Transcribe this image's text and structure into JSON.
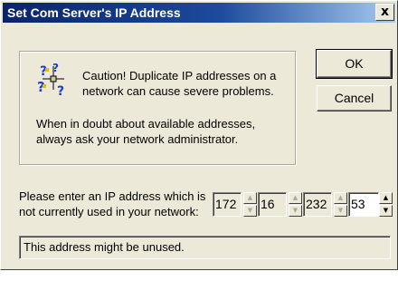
{
  "window": {
    "title": "Set Com Server's IP Address",
    "close_glyph": "x"
  },
  "info": {
    "icon": "help-question-icon",
    "caution": "Caution! Duplicate IP addresses on a network can cause severe problems.",
    "doubt": "When in doubt about available addresses, always ask your network administrator."
  },
  "buttons": {
    "ok": "OK",
    "cancel": "Cancel"
  },
  "ip": {
    "prompt": "Please enter an IP address which is not currently used in your network:",
    "octets": [
      "172",
      "16",
      "232",
      "53"
    ],
    "up_glyph": "▲",
    "down_glyph": "▼"
  },
  "status": {
    "text": "This address might be unused."
  },
  "colors": {
    "titlebar": "#0a246a",
    "dialog_bg": "#ece9d8"
  }
}
